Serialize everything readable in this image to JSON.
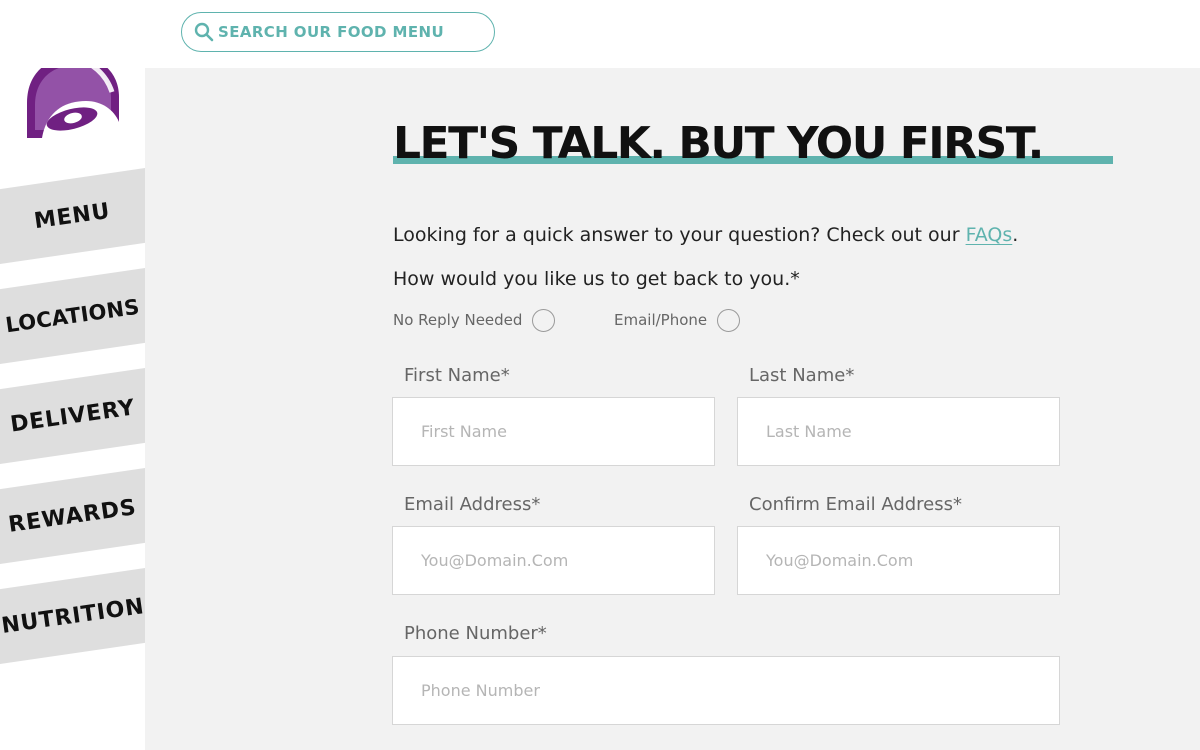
{
  "search": {
    "placeholder": "SEARCH OUR FOOD MENU",
    "value": ""
  },
  "nav": {
    "items": [
      {
        "label": "MENU"
      },
      {
        "label": "LOCATIONS"
      },
      {
        "label": "DELIVERY"
      },
      {
        "label": "REWARDS"
      },
      {
        "label": "NUTRITION"
      }
    ]
  },
  "page": {
    "headline": "LET'S TALK. BUT YOU FIRST.",
    "intro_text": "Looking for a quick answer to your question? Check out our ",
    "faq_link": "FAQs",
    "intro_end": ".",
    "reply_question": "How would you like us to get back to you.*"
  },
  "reply_options": [
    {
      "label": "No Reply Needed",
      "selected": false
    },
    {
      "label": "Email/Phone",
      "selected": false
    }
  ],
  "form": {
    "first_name": {
      "label": "First Name*",
      "placeholder": "First Name",
      "value": ""
    },
    "last_name": {
      "label": "Last Name*",
      "placeholder": "Last Name",
      "value": ""
    },
    "email": {
      "label": "Email Address*",
      "placeholder": "You@Domain.Com",
      "value": ""
    },
    "confirm_email": {
      "label": "Confirm Email Address*",
      "placeholder": "You@Domain.Com",
      "value": ""
    },
    "phone": {
      "label": "Phone Number*",
      "placeholder": "Phone Number",
      "value": ""
    }
  },
  "colors": {
    "accent": "#5fb3ae",
    "brand_purple": "#702082",
    "panel_background": "#f2f2f2",
    "nav_background": "#dedede"
  },
  "icons": {
    "search": "search-icon",
    "logo": "taco-bell-bell-logo"
  }
}
